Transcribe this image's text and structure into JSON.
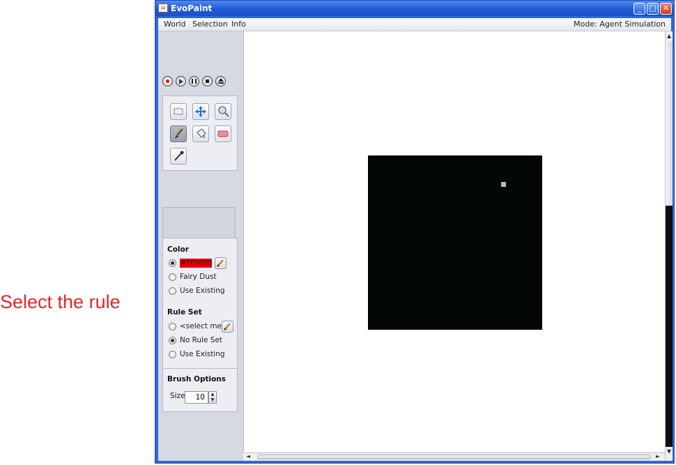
{
  "annotation": {
    "text": "Select the rule"
  },
  "window": {
    "title": "EvoPaint",
    "controls": {
      "minimize": "_",
      "maximize": "□",
      "close": "✕"
    }
  },
  "menubar": {
    "items": [
      "World",
      "Selection",
      "Info"
    ],
    "mode": "Mode: Agent Simulation"
  },
  "toolbar": {
    "playback": [
      "record",
      "play",
      "pause",
      "stop",
      "eject"
    ],
    "tools": [
      "selection-tool",
      "move-tool",
      "zoom-tool",
      "paint-brush-tool",
      "fill-tool",
      "eraser-tool",
      "pick-color-tool"
    ],
    "active_tool": "paint-brush-tool"
  },
  "color": {
    "title": "Color",
    "selected_value": "#FF0000",
    "swatch": "#FF0000",
    "fairy_dust": "Fairy Dust",
    "use_existing": "Use Existing",
    "selected": "color"
  },
  "ruleset": {
    "title": "Rule Set",
    "select_me": "<select me>",
    "no_rule_set": "No Rule Set",
    "use_existing": "Use Existing",
    "selected": "no-rule-set"
  },
  "brush": {
    "title": "Brush Options",
    "size_label": "Size",
    "size_value": "10"
  },
  "colors": {
    "title_bar": "#2a63da",
    "world": "#020607",
    "agent": "#bdbdbd",
    "annotation": "#e8242c"
  }
}
